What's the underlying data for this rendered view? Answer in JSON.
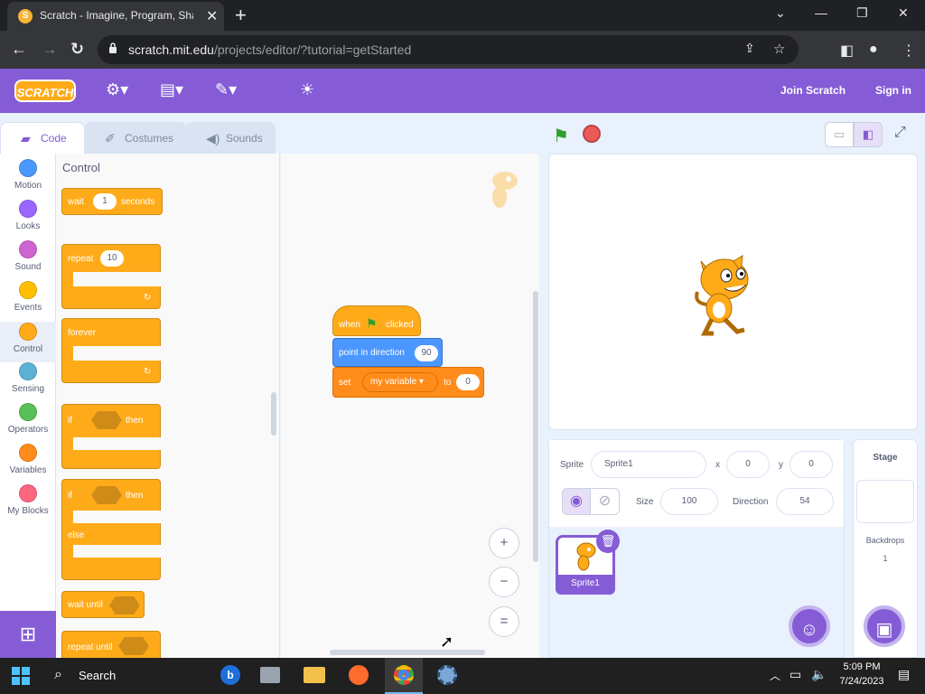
{
  "browser": {
    "tab_title": "Scratch - Imagine, Program, Shar",
    "favicon": "S",
    "close": "✕",
    "new_tab": "+",
    "window": {
      "minimize": "—",
      "maximize": "❐",
      "close": "✕",
      "dropdown": "⌄"
    },
    "url_domain": "scratch.mit.edu",
    "url_path": "/projects/editor/?tutorial=getStarted"
  },
  "menubar": {
    "logo": "SCRATCH",
    "join": "Join Scratch",
    "signin": "Sign in"
  },
  "tabs": {
    "code": "Code",
    "costumes": "Costumes",
    "sounds": "Sounds"
  },
  "categories": [
    {
      "label": "Motion",
      "color": "#4c97ff"
    },
    {
      "label": "Looks",
      "color": "#9966ff"
    },
    {
      "label": "Sound",
      "color": "#cf63cf"
    },
    {
      "label": "Events",
      "color": "#ffbf00"
    },
    {
      "label": "Control",
      "color": "#ffab19"
    },
    {
      "label": "Sensing",
      "color": "#5cb1d6"
    },
    {
      "label": "Operators",
      "color": "#59c059"
    },
    {
      "label": "Variables",
      "color": "#ff8c1a"
    },
    {
      "label": "My Blocks",
      "color": "#ff6680"
    }
  ],
  "palette": {
    "heading": "Control",
    "wait": {
      "label": "wait",
      "value": "1",
      "suffix": "seconds"
    },
    "repeat": {
      "label": "repeat",
      "value": "10"
    },
    "forever": "forever",
    "if_then": {
      "if": "if",
      "then": "then"
    },
    "if_else": {
      "if": "if",
      "then": "then",
      "else": "else"
    },
    "wait_until": "wait until",
    "repeat_until": "repeat until"
  },
  "script": {
    "when_flag": {
      "when": "when",
      "clicked": "clicked"
    },
    "point": {
      "label": "point in direction",
      "value": "90"
    },
    "set": {
      "label": "set",
      "variable": "my variable",
      "to": "to",
      "value": "0"
    }
  },
  "zoom": {
    "in": "+",
    "out": "−",
    "reset": "="
  },
  "sprite": {
    "label_sprite": "Sprite",
    "name": "Sprite1",
    "label_x": "x",
    "x": "0",
    "label_y": "y",
    "y": "0",
    "label_size": "Size",
    "size": "100",
    "label_direction": "Direction",
    "direction": "54",
    "tile_name": "Sprite1"
  },
  "stage_pane": {
    "title": "Stage",
    "backdrops_label": "Backdrops",
    "backdrops_count": "1"
  },
  "taskbar": {
    "search": "Search",
    "time": "5:09 PM",
    "date": "7/24/2023"
  }
}
